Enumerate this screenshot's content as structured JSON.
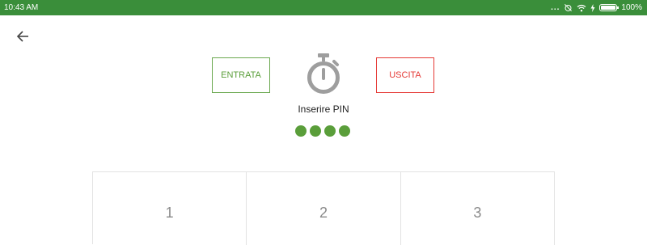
{
  "status_bar": {
    "time": "10:43 AM",
    "overflow": "...",
    "battery": "100%",
    "battery_level": 1.0,
    "icons": [
      "overflow-dots-icon",
      "alarm-off-icon",
      "wifi-icon",
      "charging-bolt-icon",
      "battery-icon"
    ]
  },
  "nav": {
    "back_icon": "arrow-left-icon"
  },
  "actions": {
    "entrata_label": "ENTRATA",
    "uscita_label": "USCITA"
  },
  "timer_icon": "stopwatch-icon",
  "pin": {
    "title": "Inserire PIN",
    "filled_count": 4,
    "dot_color": "#5a9e3a"
  },
  "keypad": {
    "keys": [
      "1",
      "2",
      "3"
    ]
  },
  "colors": {
    "status_bar": "#3a8e3a",
    "entrata": "#5a9e3a",
    "uscita": "#e53935"
  }
}
